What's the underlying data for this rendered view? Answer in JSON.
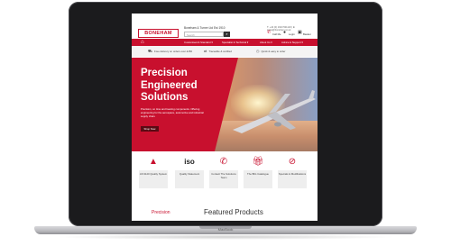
{
  "device": {
    "label": "MacBook"
  },
  "header": {
    "logo": "BONEHAM",
    "tagline": "Boneham & Turner Ltd Est 1910",
    "search_placeholder": "Search",
    "search_icon": "search-icon",
    "contact": "T: +44 (0) 1623 531123 | E: sales@boneham.co.uk",
    "utility": [
      "Call Me",
      "Login",
      "Basket"
    ]
  },
  "nav": {
    "home_icon": "home-icon",
    "items": [
      "Customised & Standard ▾",
      "Specialist & Technical ▾",
      "About Us ▾",
      "Advice & Support ▾"
    ]
  },
  "usp": [
    "Free delivery on orders over £150",
    "Traceable & certified",
    "Quick & easy to order"
  ],
  "hero": {
    "title_lines": [
      "Precision",
      "Engineered",
      "Solutions"
    ],
    "subtitle": "Precision, on time and bearing components. Offering engineering for the aerospace, automotive and industrial supply chain.",
    "button": "Shop Now",
    "accent": "#c8102e"
  },
  "features": [
    {
      "icon": "aerospace-icon",
      "label": "AS 9120 Quality System"
    },
    {
      "icon": "iso-icon",
      "label": "Quality Statement",
      "text": "iso"
    },
    {
      "icon": "phone-icon",
      "label": "Contact The Solutions Team"
    },
    {
      "icon": "gift-icon",
      "label": "The BIG Catalogue"
    },
    {
      "icon": "forbidden-icon",
      "label": "Specials & Modifications"
    }
  ],
  "bottom": {
    "left": "Precision",
    "title": "Featured Products"
  }
}
